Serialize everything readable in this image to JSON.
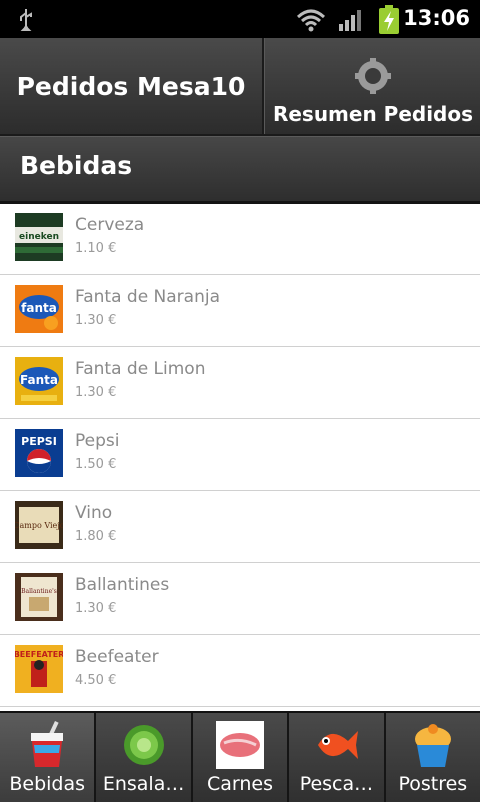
{
  "status_bar": {
    "time": "13:06"
  },
  "header": {
    "title": "Pedidos Mesa10",
    "summary_button": "Resumen Pedidos"
  },
  "section": {
    "title": "Bebidas"
  },
  "items": [
    {
      "name": "Cerveza",
      "price": "1.10 €",
      "icon": "heineken-bottle-icon"
    },
    {
      "name": "Fanta de Naranja",
      "price": "1.30 €",
      "icon": "fanta-orange-icon"
    },
    {
      "name": "Fanta de Limon",
      "price": "1.30 €",
      "icon": "fanta-lemon-icon"
    },
    {
      "name": "Pepsi",
      "price": "1.50 €",
      "icon": "pepsi-icon"
    },
    {
      "name": "Vino",
      "price": "1.80 €",
      "icon": "wine-label-icon"
    },
    {
      "name": "Ballantines",
      "price": "1.30 €",
      "icon": "ballantines-box-icon"
    },
    {
      "name": "Beefeater",
      "price": "4.50 €",
      "icon": "beefeater-bottle-icon"
    }
  ],
  "tabs": [
    {
      "label": "Bebidas",
      "icon": "drink-cup-icon",
      "active": true
    },
    {
      "label": "Ensala…",
      "icon": "lettuce-icon",
      "active": false
    },
    {
      "label": "Carnes",
      "icon": "steak-icon",
      "active": false
    },
    {
      "label": "Pesca…",
      "icon": "fish-icon",
      "active": false
    },
    {
      "label": "Postres",
      "icon": "cupcake-icon",
      "active": false
    }
  ]
}
